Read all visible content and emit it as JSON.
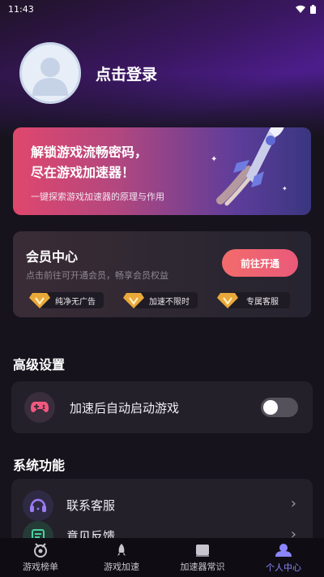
{
  "status_bar": {
    "time": "11:43"
  },
  "profile": {
    "login_label": "点击登录"
  },
  "banner": {
    "title_line1": "解锁游戏流畅密码，",
    "title_line2": "尽在游戏加速器！",
    "subtitle": "一键探索游戏加速器的原理与作用"
  },
  "vip": {
    "title": "会员中心",
    "subtitle": "点击前往可开通会员，畅享会员权益",
    "button": "前往开通",
    "perks": [
      "纯净无广告",
      "加速不限时",
      "专属客服"
    ]
  },
  "advanced": {
    "title": "高级设置",
    "auto_launch_label": "加速后自动启动游戏",
    "auto_launch_enabled": false
  },
  "system": {
    "title": "系统功能",
    "items": [
      {
        "label": "联系客服",
        "icon": "headset-icon"
      },
      {
        "label": "意见反馈",
        "icon": "feedback-icon"
      }
    ]
  },
  "tabs": [
    {
      "label": "游戏榜单",
      "icon": "ranking-icon",
      "active": false
    },
    {
      "label": "游戏加速",
      "icon": "rocket-icon",
      "active": false
    },
    {
      "label": "加速器常识",
      "icon": "book-icon",
      "active": false
    },
    {
      "label": "个人中心",
      "icon": "profile-icon",
      "active": true
    }
  ],
  "colors": {
    "accent": "#8b86ff",
    "vip_button": "#f36b6b",
    "background": "#16131c"
  }
}
